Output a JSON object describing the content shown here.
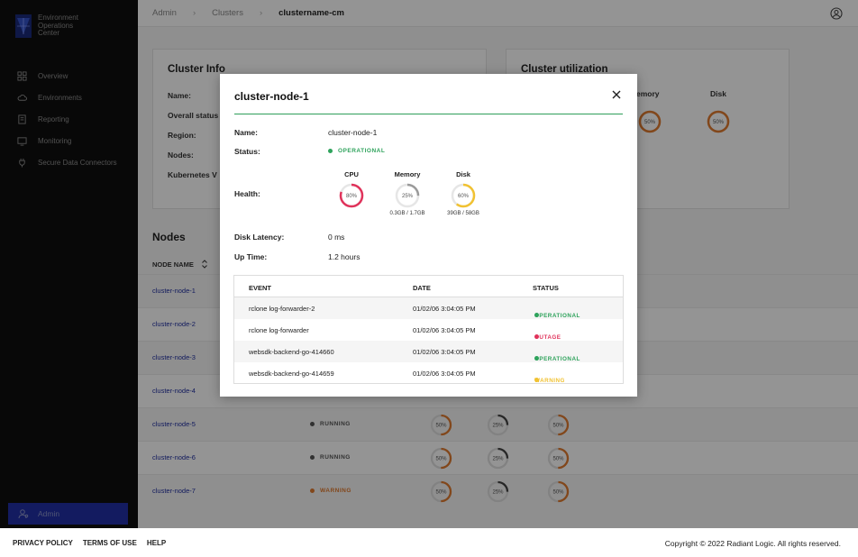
{
  "brand": {
    "line1": "Environment",
    "line2": "Operations",
    "line3": "Center"
  },
  "sidebar": {
    "items": [
      {
        "label": "Overview",
        "icon": "grid-icon"
      },
      {
        "label": "Environments",
        "icon": "cloud-icon"
      },
      {
        "label": "Reporting",
        "icon": "document-icon"
      },
      {
        "label": "Monitoring",
        "icon": "monitor-icon"
      },
      {
        "label": "Secure Data Connectors",
        "icon": "plug-icon"
      }
    ],
    "admin_label": "Admin"
  },
  "breadcrumb": {
    "item1": "Admin",
    "item2": "Clusters",
    "current": "clustername-cm"
  },
  "cluster_info": {
    "title": "Cluster Info",
    "labels": [
      "Name:",
      "Overall status",
      "Region:",
      "Nodes:",
      "Kubernetes V"
    ]
  },
  "cluster_util": {
    "title": "Cluster utilization",
    "memory_label": "emory",
    "disk_label": "Disk",
    "memory_value": "50%",
    "disk_value": "50%"
  },
  "nodes": {
    "title": "Nodes",
    "col_name": "NODE NAME",
    "rows": [
      {
        "name": "cluster-node-1"
      },
      {
        "name": "cluster-node-2"
      },
      {
        "name": "cluster-node-3"
      },
      {
        "name": "cluster-node-4"
      },
      {
        "name": "cluster-node-5",
        "status": "RUNNING",
        "status_color": "#555555",
        "g1": "50%",
        "g2": "25%",
        "g3": "50%"
      },
      {
        "name": "cluster-node-6",
        "status": "RUNNING",
        "status_color": "#555555",
        "g1": "50%",
        "g2": "25%",
        "g3": "50%"
      },
      {
        "name": "cluster-node-7",
        "status": "WARNING",
        "status_color": "#e07a2f",
        "g1": "50%",
        "g2": "25%",
        "g3": "50%"
      }
    ]
  },
  "modal": {
    "title": "cluster-node-1",
    "name_label": "Name:",
    "name_value": "cluster-node-1",
    "status_label": "Status:",
    "status_value": "OPERATIONAL",
    "health_label": "Health:",
    "cpu": {
      "label": "CPU",
      "value": "80%",
      "percent": 80,
      "color": "#e0335b"
    },
    "memory": {
      "label": "Memory",
      "value": "25%",
      "percent": 25,
      "color": "#9a9a9a",
      "detail": "0.3GB / 1.7GB"
    },
    "disk": {
      "label": "Disk",
      "value": "60%",
      "percent": 60,
      "color": "#f1c232",
      "detail": "39GB / 58GB"
    },
    "latency_label": "Disk Latency:",
    "latency_value": "0 ms",
    "uptime_label": "Up Time:",
    "uptime_value": "1.2 hours",
    "events": {
      "col_event": "EVENT",
      "col_date": "DATE",
      "col_status": "STATUS",
      "rows": [
        {
          "event": "rclone log-forwarder-2",
          "date": "01/02/06 3:04:05 PM",
          "status": "OPERATIONAL",
          "color": "#2fa35c"
        },
        {
          "event": "rclone log-forwarder",
          "date": "01/02/06 3:04:05 PM",
          "status": "OUTAGE",
          "color": "#e0335b"
        },
        {
          "event": "websdk-backend-go-414660",
          "date": "01/02/06 3:04:05 PM",
          "status": "OPERATIONAL",
          "color": "#2fa35c"
        },
        {
          "event": "websdk-backend-go-414659",
          "date": "01/02/06 3:04:05 PM",
          "status": "WARNING",
          "color": "#f1c232"
        }
      ]
    }
  },
  "footer": {
    "privacy": "PRIVACY POLICY",
    "terms": "TERMS OF USE",
    "help": "HELP",
    "copyright": "Copyright © 2022 Radiant Logic. All rights reserved."
  }
}
